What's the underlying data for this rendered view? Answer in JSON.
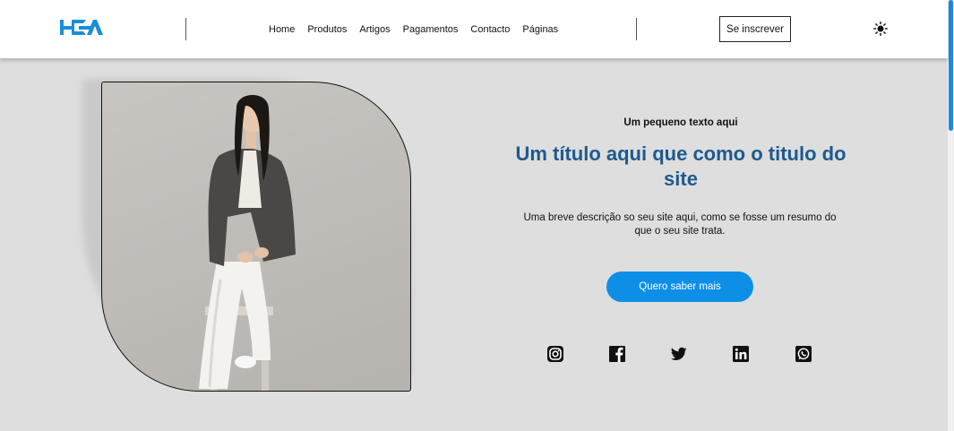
{
  "header": {
    "logo_alt": "HCA",
    "nav": [
      "Home",
      "Produtos",
      "Artigos",
      "Pagamentos",
      "Contacto",
      "Páginas"
    ],
    "subscribe_label": "Se inscrever"
  },
  "hero": {
    "eyebrow": "Um pequeno texto aqui",
    "title": "Um título aqui que como o titulo do site",
    "description": "Uma breve descrição so seu site aqui, como se fosse um resumo do que o seu site trata.",
    "cta_label": "Quero saber mais"
  },
  "socials": [
    "instagram-icon",
    "facebook-icon",
    "twitter-icon",
    "linkedin-icon",
    "whatsapp-icon"
  ],
  "colors": {
    "accent": "#0d8fe8",
    "title": "#1d5a8e",
    "logo": "#1a8fd6",
    "background": "#dedede"
  }
}
